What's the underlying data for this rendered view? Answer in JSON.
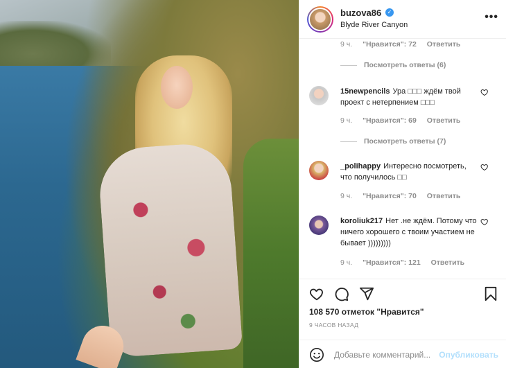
{
  "post": {
    "username": "buzova86",
    "location": "Blyde River Canyon",
    "more_label": "•••",
    "verified_glyph": "✓"
  },
  "comments_section": {
    "top_meta": {
      "time": "9 ч.",
      "likes": "\"Нравится\": 72",
      "reply": "Ответить"
    },
    "top_view_replies": "Посмотреть ответы (6)",
    "items": [
      {
        "username": "15newpencils",
        "text": "Ура □□□ ждём твой проект с нетерпением □□□",
        "time": "9 ч.",
        "likes": "\"Нравится\": 69",
        "reply": "Ответить",
        "view_replies": "Посмотреть ответы (7)"
      },
      {
        "username": "_polihappy",
        "text": "Интересно посмотреть, что получилось □□",
        "time": "9 ч.",
        "likes": "\"Нравится\": 70",
        "reply": "Ответить"
      },
      {
        "username": "koroliuk217",
        "text": "Нет .не ждём. Потому что ничего хорошего с твоим участием не бывает )))))))))",
        "time": "9 ч.",
        "likes": "\"Нравится\": 121",
        "reply": "Ответить"
      }
    ]
  },
  "footer": {
    "likes_count": "108 570 отметок \"Нравится\"",
    "timestamp": "9 ЧАСОВ НАЗАД",
    "comment_placeholder": "Добавьте комментарий...",
    "publish_label": "Опубликовать"
  },
  "icons": {
    "like": "heart-icon",
    "comment": "comment-icon",
    "share": "share-icon",
    "save": "bookmark-icon",
    "emoji": "emoji-icon",
    "options": "more-icon"
  },
  "colors": {
    "accent": "#3897f0",
    "publish_disabled": "#b2dffc",
    "muted": "#8e8e8e",
    "text": "#262626"
  }
}
